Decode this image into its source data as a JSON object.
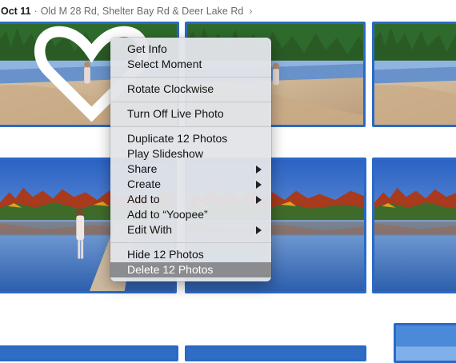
{
  "header": {
    "date": "Oct 11",
    "separator": "·",
    "location": "Old M 28 Rd, Shelter Bay Rd & Deer Lake Rd",
    "chevron": "›"
  },
  "photos": [
    {
      "name": "photo-1",
      "has_person": true,
      "scene": "beach",
      "icon": "heart-icon"
    },
    {
      "name": "photo-2",
      "has_person": true,
      "scene": "beach"
    },
    {
      "name": "photo-3",
      "has_person": false,
      "scene": "beach"
    },
    {
      "name": "photo-4",
      "has_person": true,
      "scene": "lake"
    },
    {
      "name": "photo-5",
      "has_person": false,
      "scene": "lake"
    },
    {
      "name": "photo-6",
      "has_person": false,
      "scene": "lake"
    },
    {
      "name": "photo-7",
      "has_person": false,
      "scene": "lake"
    },
    {
      "name": "photo-8",
      "has_person": false,
      "scene": "lake"
    },
    {
      "name": "photo-9",
      "has_person": false,
      "scene": "lake"
    }
  ],
  "context_menu": {
    "items": [
      {
        "label": "Get Info",
        "submenu": false
      },
      {
        "label": "Select Moment",
        "submenu": false
      },
      {
        "label": "Rotate Clockwise",
        "submenu": false
      },
      {
        "label": "Turn Off Live Photo",
        "submenu": false
      },
      {
        "label": "Duplicate 12 Photos",
        "submenu": false
      },
      {
        "label": "Play Slideshow",
        "submenu": false
      },
      {
        "label": "Share",
        "submenu": true
      },
      {
        "label": "Create",
        "submenu": true
      },
      {
        "label": "Add to",
        "submenu": true
      },
      {
        "label": "Add to “Yoopee”",
        "submenu": false
      },
      {
        "label": "Edit With",
        "submenu": true
      },
      {
        "label": "Hide 12 Photos",
        "submenu": false
      },
      {
        "label": "Delete 12 Photos",
        "submenu": false,
        "highlighted": true
      }
    ]
  },
  "colors": {
    "selection_border": "#2a69c7",
    "menu_highlight": "#8b8c90"
  }
}
